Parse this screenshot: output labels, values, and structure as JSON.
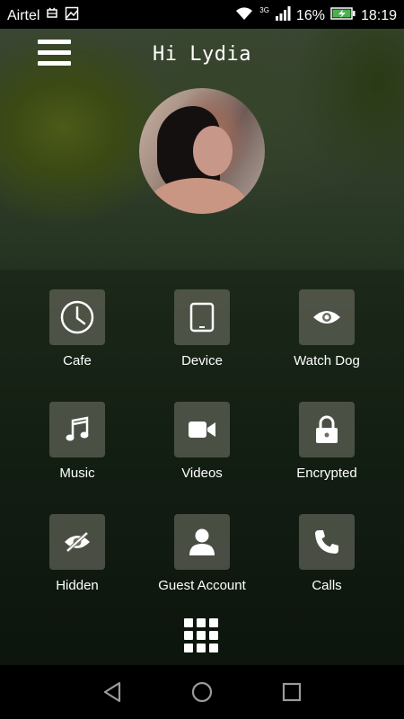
{
  "status_bar": {
    "carrier": "Airtel",
    "network": "3G",
    "battery": "16%",
    "time": "18:19"
  },
  "header": {
    "greeting": "Hi Lydia"
  },
  "tiles": [
    {
      "label": "Cafe",
      "icon": "clock-icon"
    },
    {
      "label": "Device",
      "icon": "tablet-icon"
    },
    {
      "label": "Watch Dog",
      "icon": "eye-icon"
    },
    {
      "label": "Music",
      "icon": "music-note-icon"
    },
    {
      "label": "Videos",
      "icon": "video-camera-icon"
    },
    {
      "label": "Encrypted",
      "icon": "lock-icon"
    },
    {
      "label": "Hidden",
      "icon": "eye-slash-icon"
    },
    {
      "label": "Guest Account",
      "icon": "user-icon"
    },
    {
      "label": "Calls",
      "icon": "phone-icon"
    }
  ],
  "bottom": {
    "apps_icon": "apps-grid-icon"
  },
  "nav": {
    "back_icon": "back-triangle-icon",
    "home_icon": "home-circle-icon",
    "recents_icon": "recents-square-icon"
  },
  "colors": {
    "tile_bg": "#78786e",
    "text": "#ffffff",
    "status_bar_bg": "#000000",
    "battery_fill": "#4caf50"
  }
}
